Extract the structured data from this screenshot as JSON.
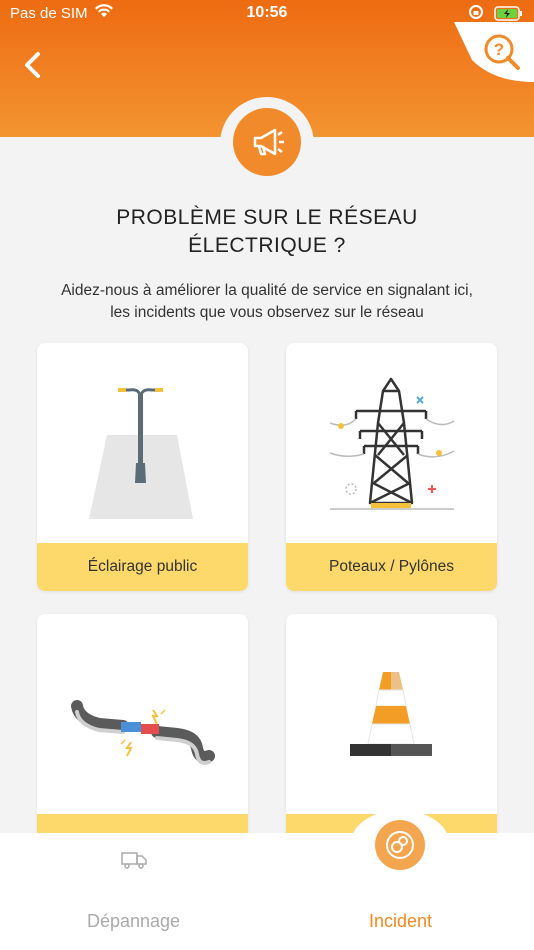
{
  "status_bar": {
    "carrier": "Pas de SIM",
    "time": "10:56"
  },
  "header": {
    "back_icon": "chevron-left-icon",
    "search_icon": "search-question-icon",
    "hero_icon": "megaphone-icon"
  },
  "main": {
    "title_line1": "PROBLÈME SUR LE RÉSEAU",
    "title_line2": "ÉLECTRIQUE ?",
    "subtitle_line1": "Aidez-nous à améliorer la qualité de service en signalant ici,",
    "subtitle_line2": "les incidents que vous observez sur le réseau"
  },
  "cards": [
    {
      "label": "Éclairage public",
      "icon": "street-lamp-icon"
    },
    {
      "label": "Poteaux / Pylônes",
      "icon": "pylon-icon"
    },
    {
      "label": "",
      "icon": "cable-icon"
    },
    {
      "label": "",
      "icon": "traffic-cone-icon"
    }
  ],
  "tabbar": {
    "left_label": "Dépannage",
    "right_label": "Incident",
    "left_icon": "truck-icon",
    "right_icon": "incident-icon"
  },
  "colors": {
    "orange": "#f18a2a",
    "yellow": "#fdd86a"
  }
}
